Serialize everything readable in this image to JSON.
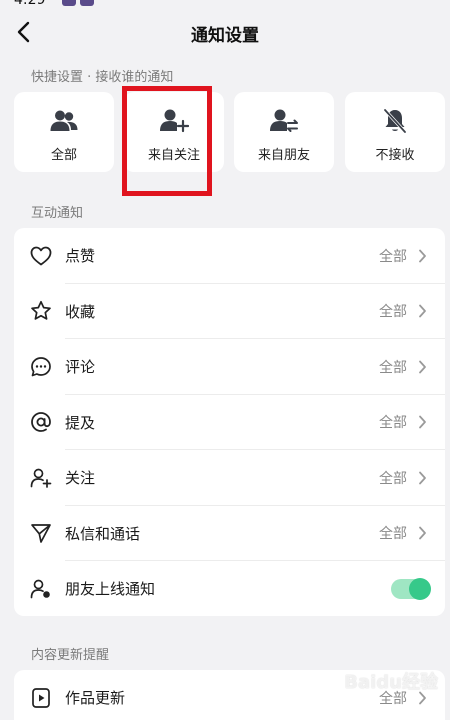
{
  "status_bar": {
    "time": "4:29"
  },
  "header": {
    "title": "通知设置"
  },
  "quick": {
    "section_title": "快捷设置 · 接收谁的通知",
    "cards": [
      {
        "label": "全部",
        "icon": "two-users-icon"
      },
      {
        "label": "来自关注",
        "icon": "user-plus-icon"
      },
      {
        "label": "来自朋友",
        "icon": "user-swap-icon"
      },
      {
        "label": "不接收",
        "icon": "bell-off-icon"
      }
    ]
  },
  "interaction": {
    "section_title": "互动通知",
    "rows": [
      {
        "label": "点赞",
        "value": "全部",
        "icon": "heart-icon"
      },
      {
        "label": "收藏",
        "value": "全部",
        "icon": "star-icon"
      },
      {
        "label": "评论",
        "value": "全部",
        "icon": "comment-icon"
      },
      {
        "label": "提及",
        "value": "全部",
        "icon": "at-icon"
      },
      {
        "label": "关注",
        "value": "全部",
        "icon": "user-plus-icon"
      },
      {
        "label": "私信和通话",
        "value": "全部",
        "icon": "send-icon"
      },
      {
        "label": "朋友上线通知",
        "icon": "user-online-icon",
        "toggle": true
      }
    ]
  },
  "content": {
    "section_title": "内容更新提醒",
    "rows": [
      {
        "label": "作品更新",
        "value": "全部",
        "icon": "video-icon"
      }
    ]
  },
  "watermark": {
    "text": "Baidu经验"
  },
  "colors": {
    "highlight": "#e0141e",
    "toggle_on": "#36c98a",
    "background": "#f2f2f4"
  }
}
